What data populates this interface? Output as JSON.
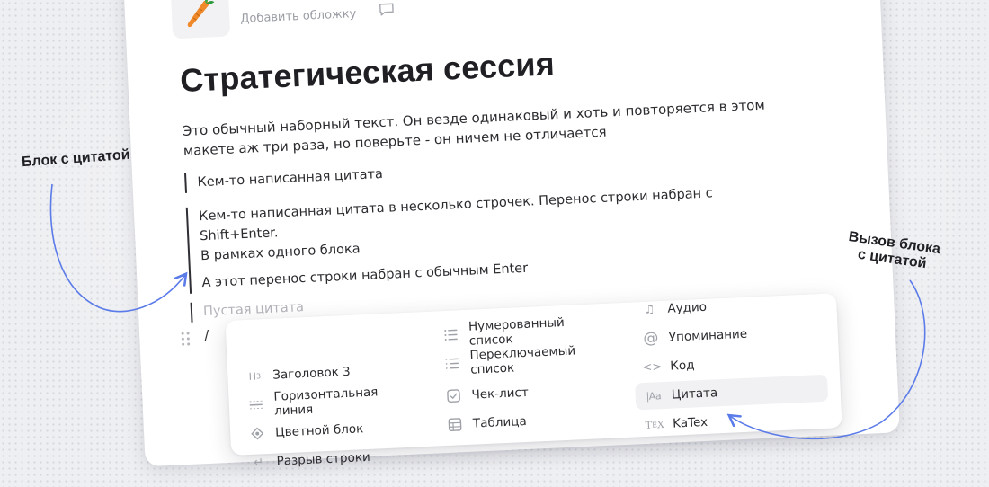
{
  "header": {
    "emoji_name": "carrot-icon",
    "add_cover": "Добавить обложку"
  },
  "title": "Стратегическая сессия",
  "paragraph": "Это обычный наборный текст. Он везде одинаковый и хоть и повторяется в этом макете аж три раза, но поверьте - он ничем не отличается",
  "quotes": {
    "single": "Кем-то написанная цитата",
    "multi_lines": [
      "Кем-то написанная цитата в несколько строчек. Перенос строки  набран с Shift+Enter.",
      "В рамках одного блока",
      "А этот перенос строки набран с обычным Enter"
    ],
    "empty_placeholder": "Пустая цитата"
  },
  "slash_input": "/",
  "menu": {
    "col1": [
      {
        "label": "Заголовок 3",
        "icon": "heading-3-icon"
      },
      {
        "label": "Горизонтальная линия",
        "icon": "horizontal-line-icon"
      },
      {
        "label": "Цветной блок",
        "icon": "color-block-icon"
      },
      {
        "label": "Разрыв строки",
        "icon": "line-break-icon"
      }
    ],
    "col2": [
      {
        "label": "Нумерованный список",
        "icon": "numbered-list-icon"
      },
      {
        "label": "Переключаемый список",
        "icon": "toggle-list-icon"
      },
      {
        "label": "Чек-лист",
        "icon": "checklist-icon"
      },
      {
        "label": "Таблица",
        "icon": "table-icon"
      }
    ],
    "col3": [
      {
        "label": "Аудио",
        "icon": "audio-icon"
      },
      {
        "label": "Упоминание",
        "icon": "mention-icon"
      },
      {
        "label": "Код",
        "icon": "code-icon"
      },
      {
        "label": "Цитата",
        "icon": "quote-icon",
        "active": true
      },
      {
        "label": "KaTex",
        "icon": "katex-icon"
      }
    ]
  },
  "annotations": {
    "left": "Блок с цитатой",
    "right_line1": "Вызов блока",
    "right_line2": "с цитатой"
  },
  "colors": {
    "arrow": "#5b7be9",
    "text": "#2b2b30",
    "muted": "#9ea1a8",
    "active_bg": "#f1f1f4"
  }
}
